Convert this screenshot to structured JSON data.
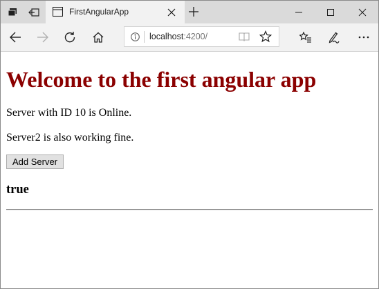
{
  "browser": {
    "tab": {
      "title": "FirstAngularApp",
      "icon": "page-icon"
    },
    "address": {
      "host": "localhost",
      "port_path": ":4200/"
    },
    "nav_icons": [
      "back-icon",
      "forward-icon",
      "refresh-icon",
      "home-icon"
    ],
    "toolbar_icons": [
      "favorites-icon",
      "notes-icon",
      "more-icon"
    ],
    "window_controls": [
      "minimize-icon",
      "maximize-icon",
      "close-icon"
    ]
  },
  "page": {
    "heading": "Welcome to the first angular app",
    "server_status": "Server with ID 10 is Online.",
    "server2_status": "Server2 is also working fine.",
    "add_server_button": "Add Server",
    "allow_new_server": "true",
    "heading_color": "#8b0000"
  }
}
